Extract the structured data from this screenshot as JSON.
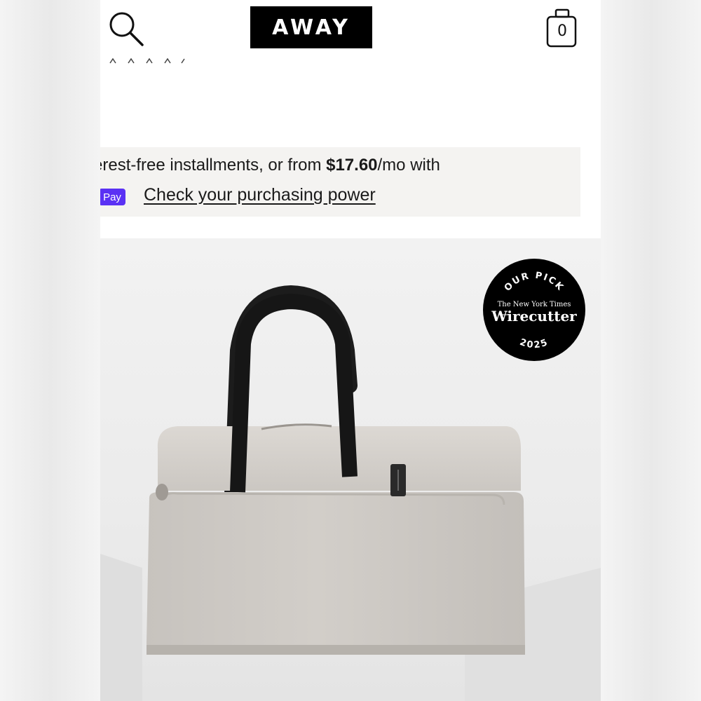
{
  "header": {
    "logo_text": "AWAY",
    "cart_count": "0",
    "search_icon": "search-icon",
    "cart_icon": "cart-icon"
  },
  "promo": {
    "line1_pre": "erest-free installments, or from ",
    "price": "$17.60",
    "line1_post": "/mo with",
    "pay_badge": "Pay",
    "link_label": "Check your purchasing power",
    "pay_color": "#5a31f4"
  },
  "badge": {
    "top_text": "OUR PICK",
    "publisher": "The New York Times",
    "brand": "Wirecutter",
    "year": "2025"
  },
  "colors": {
    "header_logo_bg": "#000000",
    "bag_body": "#cfcbc6",
    "handle": "#1c1c1c"
  }
}
